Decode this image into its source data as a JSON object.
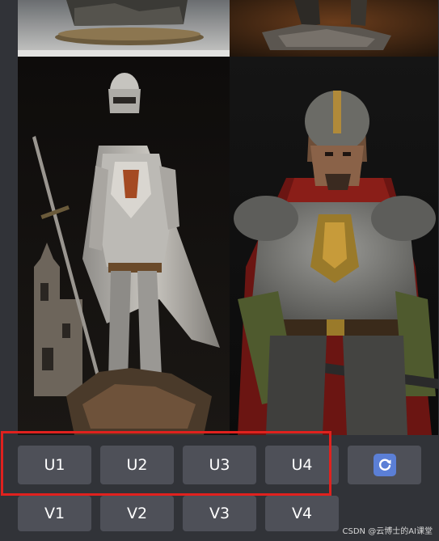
{
  "images": [
    {
      "id": "tile-1",
      "subject": "statue-base"
    },
    {
      "id": "tile-2",
      "subject": "statue-base"
    },
    {
      "id": "tile-3",
      "subject": "crusader-knight-statue"
    },
    {
      "id": "tile-4",
      "subject": "armored-warrior-statue"
    }
  ],
  "upscale_buttons": [
    "U1",
    "U2",
    "U3",
    "U4"
  ],
  "variation_buttons": [
    "V1",
    "V2",
    "V3",
    "V4"
  ],
  "reroll_icon": "refresh-icon",
  "watermark": "CSDN @云博士的AI课堂",
  "colors": {
    "background": "#313338",
    "button": "#4e5058",
    "button_text": "#ffffff",
    "reroll_accent": "#5b7fd6",
    "highlight_border": "#e0211e"
  }
}
